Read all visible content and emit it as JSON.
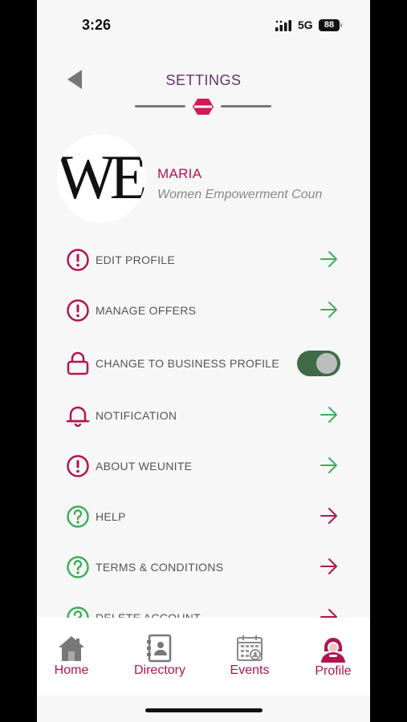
{
  "status_bar": {
    "time": "3:26",
    "network": "5G",
    "battery": "88"
  },
  "header": {
    "title": "SETTINGS"
  },
  "profile": {
    "avatar_text": "WE",
    "name": "MARIA",
    "organization": "Women Empowerment Coun"
  },
  "menu": [
    {
      "label": "EDIT PROFILE",
      "icon": "alert-circle-icon",
      "action": "arrow-right-icon"
    },
    {
      "label": "MANAGE OFFERS",
      "icon": "alert-circle-icon",
      "action": "arrow-right-icon"
    },
    {
      "label": "CHANGE TO BUSINESS PROFILE",
      "icon": "lock-icon",
      "action": "toggle",
      "toggle_on": true
    },
    {
      "label": "NOTIFICATION",
      "icon": "bell-icon",
      "action": "arrow-right-icon"
    },
    {
      "label": "ABOUT WEUNITE",
      "icon": "alert-circle-icon",
      "action": "arrow-right-icon"
    },
    {
      "label": "HELP",
      "icon": "help-circle-icon",
      "action": "arrow-right-icon"
    },
    {
      "label": "TERMS & CONDITIONS",
      "icon": "help-circle-icon",
      "action": "arrow-right-icon"
    },
    {
      "label": "DELETE ACCOUNT",
      "icon": "help-circle-icon",
      "action": "arrow-right-icon"
    }
  ],
  "bottom_nav": [
    {
      "label": "Home",
      "icon": "home-icon"
    },
    {
      "label": "Directory",
      "icon": "directory-icon"
    },
    {
      "label": "Events",
      "icon": "calendar-icon"
    },
    {
      "label": "Profile",
      "icon": "profile-icon",
      "active": true
    }
  ],
  "colors": {
    "primary": "#b0154f",
    "title_purple": "#6b2f73",
    "green_arrow": "#3fae5c",
    "green_icon": "#3fae5c",
    "toggle_on": "#3f6b47"
  }
}
